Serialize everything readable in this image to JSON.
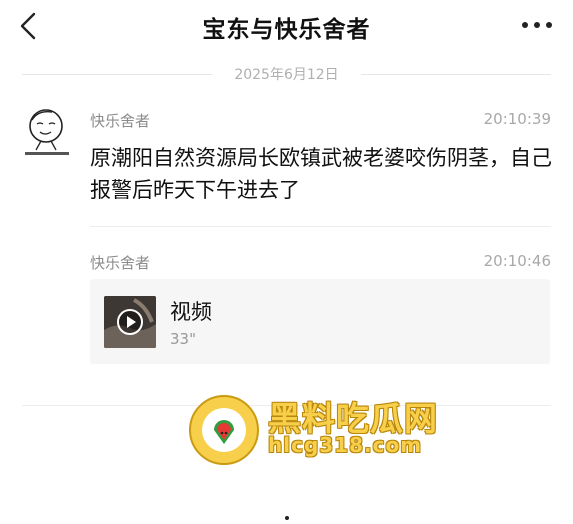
{
  "header": {
    "title": "宝东与快乐舍者",
    "back_icon": "chevron-left-icon",
    "more_icon": "more-dots-icon"
  },
  "date_divider": "2025年6月12日",
  "messages": [
    {
      "sender": "快乐舍者",
      "time": "20:10:39",
      "text": "原潮阳自然资源局长欧镇武被老婆咬伤阴茎，自己报警后昨天下午进去了"
    },
    {
      "sender": "快乐舍者",
      "time": "20:10:46",
      "video": {
        "title": "视频",
        "duration": "33\""
      }
    }
  ],
  "watermark": {
    "name": "黑料吃瓜网",
    "url": "hlcg318.com"
  },
  "colors": {
    "background": "#ffffff",
    "card": "#f6f6f6",
    "secondary_text": "#8c8c8c",
    "watermark_gold": "#f7cf4a"
  }
}
